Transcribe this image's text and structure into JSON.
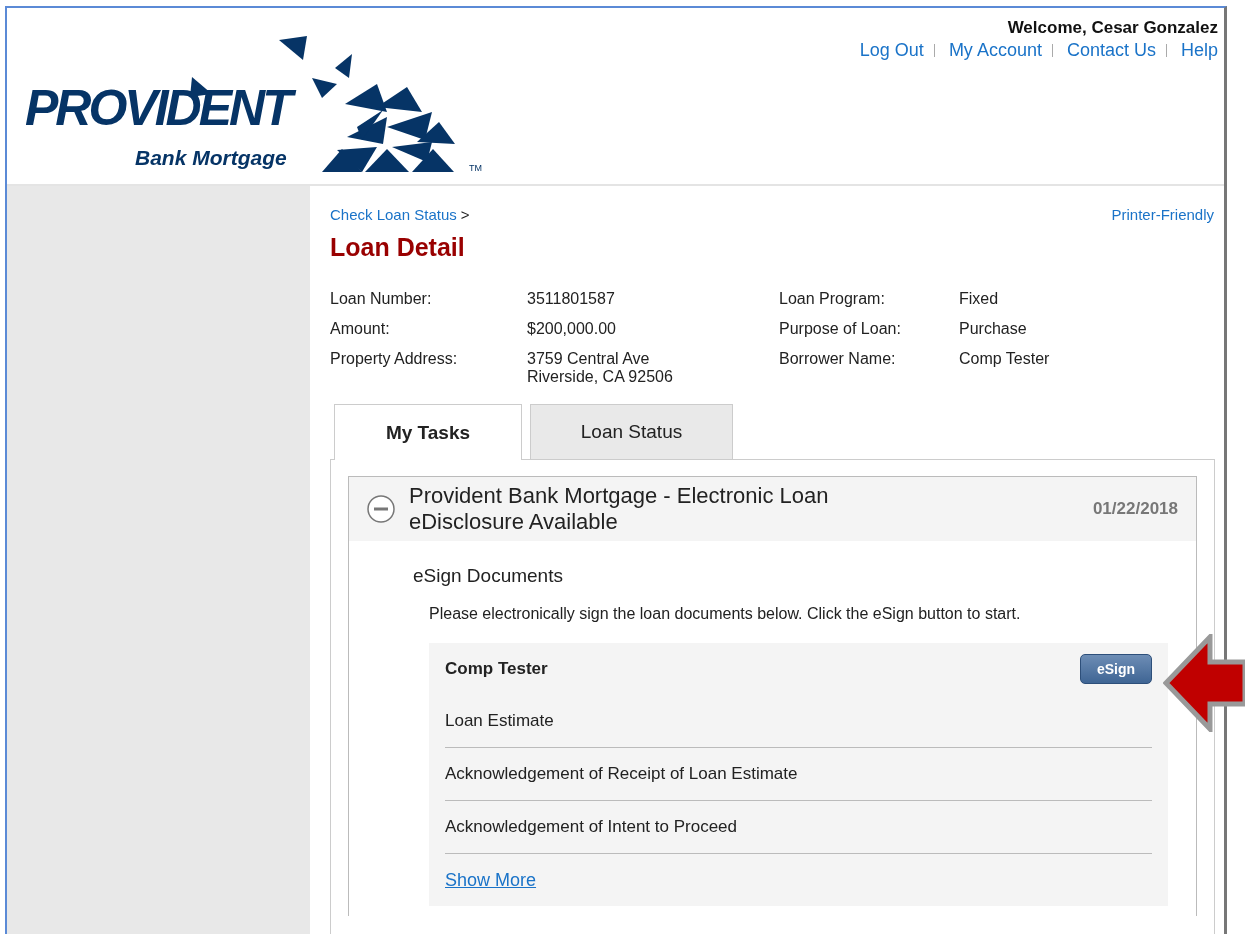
{
  "logo": {
    "name": "PROVIDENT",
    "tagline": "Bank Mortgage",
    "trademark": "TM"
  },
  "user_bar": {
    "welcome": "Welcome, Cesar Gonzalez",
    "links": [
      "Log Out",
      "My Account",
      "Contact Us",
      "Help"
    ]
  },
  "breadcrumb": {
    "link": "Check Loan Status",
    "separator": ">"
  },
  "printer_link": "Printer-Friendly",
  "page_title": "Loan Detail",
  "loan_details": [
    {
      "label": "Loan Number:",
      "value": "3511801587"
    },
    {
      "label": "Loan Program:",
      "value": "Fixed"
    },
    {
      "label": "Amount:",
      "value": "$200,000.00"
    },
    {
      "label": "Purpose of Loan:",
      "value": "Purchase"
    },
    {
      "label": "Property Address:",
      "value": "3759 Central Ave\nRiverside, CA 92506"
    },
    {
      "label": "Borrower Name:",
      "value": "Comp Tester"
    }
  ],
  "tabs": [
    {
      "label": "My Tasks",
      "selected": true
    },
    {
      "label": "Loan Status",
      "selected": false
    }
  ],
  "task": {
    "title": "Provident Bank Mortgage - Electronic Loan\neDisclosure Available",
    "date": "01/22/2018",
    "expanded": true,
    "section_title": "eSign Documents",
    "instruction": "Please electronically sign the loan documents below. Click the eSign button to start.",
    "signer": "Comp Tester",
    "esign_button": "eSign",
    "documents": [
      "Loan Estimate",
      "Acknowledgement of Receipt of Loan Estimate",
      "Acknowledgement of Intent to Proceed"
    ],
    "show_more": "Show More"
  }
}
